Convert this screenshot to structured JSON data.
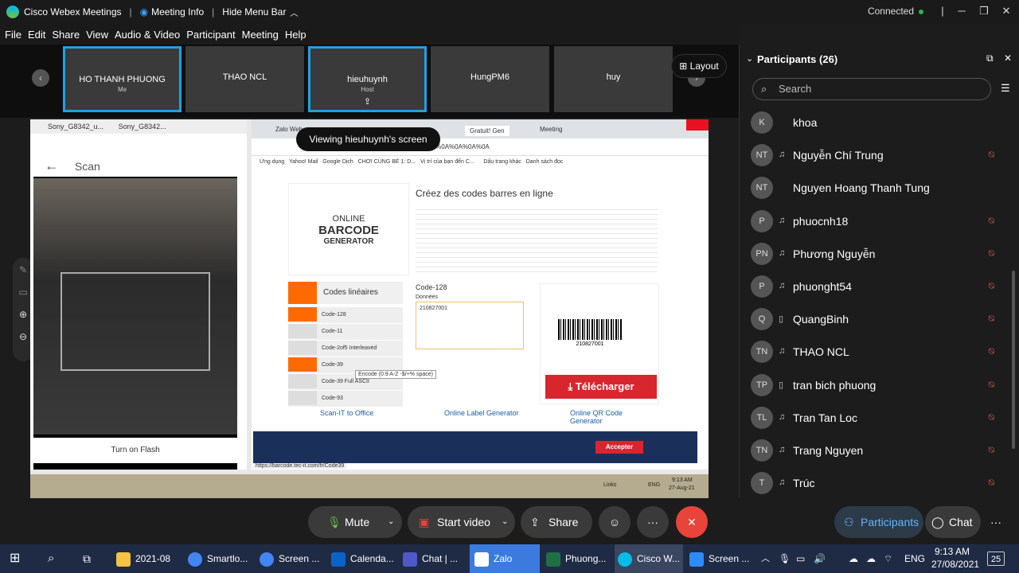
{
  "titlebar": {
    "app_name": "Cisco Webex Meetings",
    "meeting_info": "Meeting Info",
    "hide_menu": "Hide Menu Bar",
    "status": "Connected"
  },
  "menu": [
    "File",
    "Edit",
    "Share",
    "View",
    "Audio & Video",
    "Participant",
    "Meeting",
    "Help"
  ],
  "thumbnails": [
    {
      "name": "HO THANH PHUONG",
      "sub": "Me"
    },
    {
      "name": "THAO NCL",
      "sub": ""
    },
    {
      "name": "hieuhuynh",
      "sub": "Host"
    },
    {
      "name": "HungPM6",
      "sub": ""
    },
    {
      "name": "huy",
      "sub": ""
    }
  ],
  "layout_label": "Layout",
  "viewing_banner": "Viewing hieuhuynh's screen",
  "shared": {
    "left_tabs": [
      "Sony_G8342_u...",
      "Sony_G8342..."
    ],
    "scan_title": "Scan",
    "flash_btn": "Turn on Flash",
    "chrome_tabs": [
      "Zalo Web",
      "Gratuit! Gen",
      "Meeting"
    ],
    "url": "0827001%0A%0A%0A%0A",
    "bookmarks": [
      "Ứng dụng",
      "Yahoo! Mail",
      "Google Dịch",
      "CHƠI CÙNG BÉ 1: D...",
      "Vị trí của bạn đến C...",
      "Dấu trang khác",
      "Danh sách đọc"
    ],
    "heading": "Créez des codes barres en ligne",
    "brand": [
      "ONLINE",
      "BARCODE",
      "GENERATOR"
    ],
    "side_title": "Codes linéaires",
    "side_items": [
      "Code-128",
      "Code-11",
      "Code-2of5 Interleaved",
      "Code-39",
      "Code-39 Full ASCII",
      "Code-93"
    ],
    "code_type": "Code-128",
    "data_label": "Données",
    "data_value": "210827001",
    "barcode_text": "210827001",
    "download_btn": "Télécharger",
    "tooltip": "Encode (0.9 A-Z -$/+% space)",
    "promos": [
      "Scan-IT to Office",
      "Online Label Generator",
      "Online QR Code Generator"
    ],
    "cookie_btn": "Accepter",
    "status_url": "https://barcode.tec-it.com/fr/Code39",
    "clock_time": "9:13 AM",
    "clock_date": "27-Aug-21",
    "lang": "ENG",
    "links": "Links"
  },
  "controls": {
    "mute": "Mute",
    "video": "Start video",
    "share": "Share",
    "participants": "Participants",
    "chat": "Chat"
  },
  "participants": {
    "title": "Participants (26)",
    "search_placeholder": "Search",
    "list": [
      {
        "initials": "K",
        "name": "khoa",
        "device": "",
        "muted": false
      },
      {
        "initials": "NT",
        "name": "Nguyễn Chí Trung",
        "device": "headset",
        "muted": true
      },
      {
        "initials": "NT",
        "name": "Nguyen Hoang Thanh Tung",
        "device": "",
        "muted": false
      },
      {
        "initials": "P",
        "name": "phuocnh18",
        "device": "headset",
        "muted": true
      },
      {
        "initials": "PN",
        "name": "Phương Nguyễn",
        "device": "headset",
        "muted": true
      },
      {
        "initials": "P",
        "name": "phuonght54",
        "device": "headset",
        "muted": true
      },
      {
        "initials": "Q",
        "name": "QuangBinh",
        "device": "phone",
        "muted": true
      },
      {
        "initials": "TN",
        "name": "THAO NCL",
        "device": "headset",
        "muted": true
      },
      {
        "initials": "TP",
        "name": "tran bich phuong",
        "device": "phone",
        "muted": true
      },
      {
        "initials": "TL",
        "name": "Tran Tan Loc",
        "device": "headset",
        "muted": true
      },
      {
        "initials": "TN",
        "name": "Trang Nguyen",
        "device": "headset",
        "muted": true
      },
      {
        "initials": "T",
        "name": "Trúc",
        "device": "headset",
        "muted": true
      }
    ]
  },
  "taskbar": {
    "items": [
      "2021-08",
      "Smartlo...",
      "Screen ...",
      "Calenda...",
      "Chat | ...",
      "Zalo",
      "Phuong...",
      "Cisco W...",
      "Screen ..."
    ],
    "lang": "ENG",
    "time": "9:13 AM",
    "date": "27/08/2021",
    "notif": "25"
  },
  "colors": {
    "accent": "#1aa3e6",
    "end_call": "#e8443a",
    "download": "#d8262e",
    "barcode_orange": "#ff6a00",
    "taskbar": "#1f2b44"
  }
}
